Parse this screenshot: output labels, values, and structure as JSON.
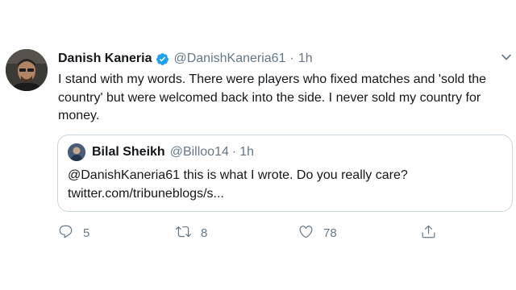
{
  "author": {
    "name": "Danish Kaneria",
    "handle": "@DanishKaneria61",
    "time": "1h",
    "separator": "·"
  },
  "tweet": {
    "lines": [
      "I stand with my words. There were players who fixed matches and 'sold the",
      "country' but were welcomed back into the side. I never sold my country for",
      "money."
    ]
  },
  "quote": {
    "name": "Bilal Sheikh",
    "handle": "@Billoo14",
    "separator": "·",
    "time": "1h",
    "lines": [
      "@DanishKaneria61 this is what I wrote. Do you really care?",
      "twitter.com/tribuneblogs/s..."
    ]
  },
  "actions": {
    "reply_count": "5",
    "retweet_count": "8",
    "like_count": "78"
  },
  "icons": {
    "verified": "verified-badge-icon",
    "more": "chevron-down-icon",
    "reply": "reply-icon",
    "retweet": "retweet-icon",
    "like": "heart-icon",
    "share": "share-icon"
  },
  "colors": {
    "verified": "#1da1f2",
    "secondary_text": "#657786",
    "primary_text": "#14171a",
    "border": "#ccd6dd"
  }
}
